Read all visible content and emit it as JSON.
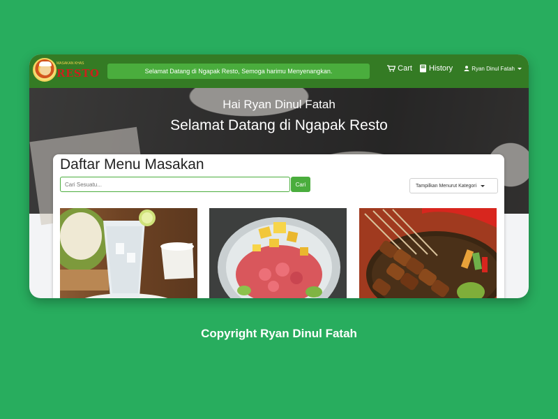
{
  "navbar": {
    "logo": {
      "name": "RESTO",
      "tagline": "MASAKAN KHAS"
    },
    "marquee_text": "Selamat Datang di Ngapak Resto, Semoga harimu Menyenangkan.",
    "links": [
      {
        "label": "Cart",
        "icon": "cart-icon"
      },
      {
        "label": "History",
        "icon": "book-icon"
      }
    ],
    "user": {
      "label": "Ryan Dinul Fatah",
      "icon": "user-icon"
    }
  },
  "hero": {
    "greeting": "Hai Ryan Dinul Fatah",
    "title": "Selamat Datang di Ngapak Resto"
  },
  "menu": {
    "title": "Daftar Menu Masakan",
    "search": {
      "placeholder": "Cari Sesuatu...",
      "value": "",
      "button": "Cari"
    },
    "category_select": "Tampilkan Menurut Kategori",
    "items": [
      {
        "image": "coconut-drink-image"
      },
      {
        "image": "shaved-ice-dessert-image"
      },
      {
        "image": "satay-image"
      }
    ]
  },
  "footer": {
    "copyright": "Copyright Ryan Dinul Fatah"
  },
  "colors": {
    "background": "#28ad5e",
    "navbar": "#347b24",
    "accent": "#4aad3d"
  }
}
